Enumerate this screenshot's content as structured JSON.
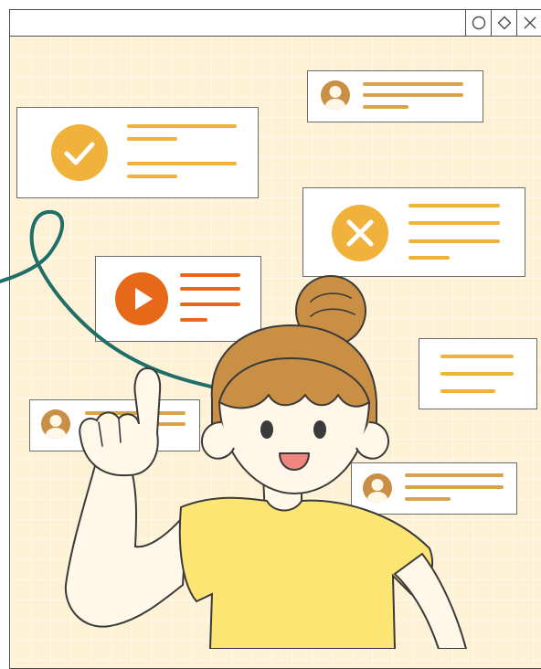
{
  "window": {
    "controls": [
      "minimize-circle",
      "maximize-diamond",
      "close-x"
    ]
  },
  "cards": {
    "check": {
      "icon": "check-circle-icon"
    },
    "play": {
      "icon": "play-circle-icon"
    },
    "cancel": {
      "icon": "x-circle-icon"
    },
    "profile_top": {
      "icon": "user-avatar-icon"
    },
    "profile_left": {
      "icon": "user-avatar-icon"
    },
    "profile_right": {
      "icon": "user-avatar-icon"
    },
    "text_only": {
      "icon": ""
    }
  },
  "colors": {
    "background": "#fdf1d6",
    "accent_gold": "#f0b23a",
    "accent_orange": "#e8681a",
    "accent_tan": "#d9a34c",
    "hair": "#c98f45",
    "shirt": "#fde574",
    "skin": "#fff7e8",
    "string": "#1f6e68"
  },
  "illustration": {
    "subject": "cartoon-woman-pointing-up"
  }
}
